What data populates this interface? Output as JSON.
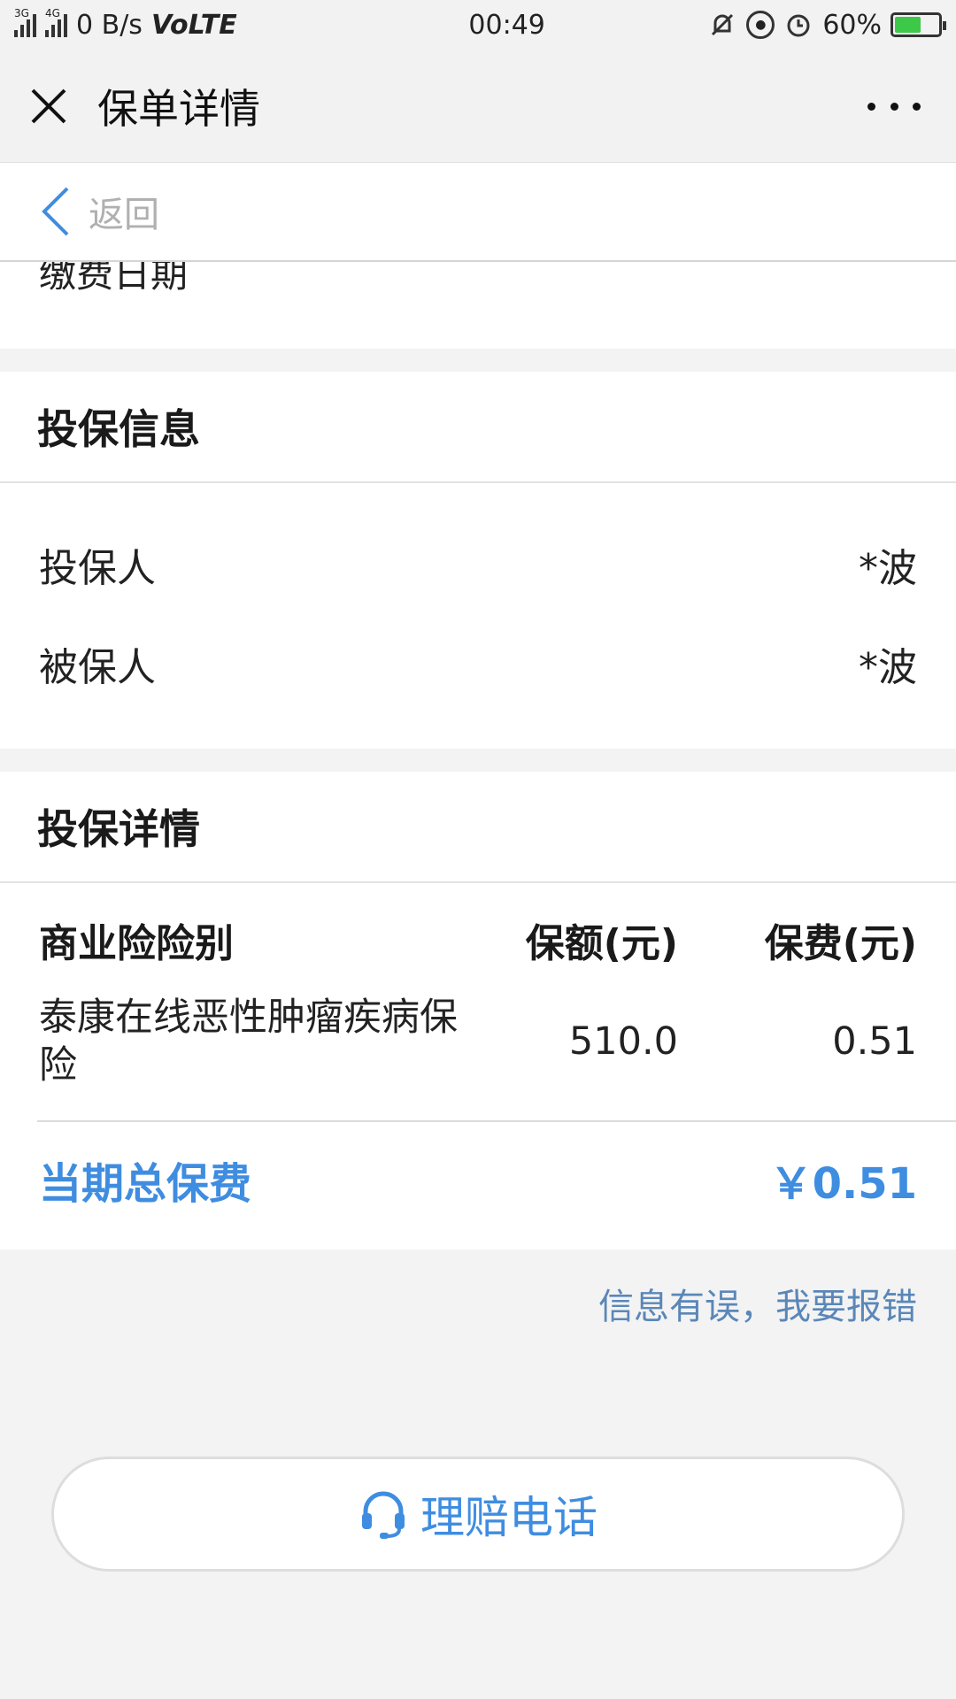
{
  "status_bar": {
    "net_3g": "3G",
    "net_4g": "4G",
    "speed": "0 B/s",
    "volte": "VoLTE",
    "time": "00:49",
    "battery": "60%"
  },
  "header": {
    "title": "保单详情"
  },
  "nav": {
    "back_label": "返回"
  },
  "payment": {
    "date_label": "缴费日期"
  },
  "insured_info": {
    "title": "投保信息",
    "rows": [
      {
        "label": "投保人",
        "value": "*波"
      },
      {
        "label": "被保人",
        "value": "*波"
      }
    ]
  },
  "details": {
    "title": "投保详情",
    "columns": [
      "商业险险别",
      "保额(元)",
      "保费(元)"
    ],
    "rows": [
      {
        "name": "泰康在线恶性肿瘤疾病保险",
        "amount": "510.0",
        "premium": "0.51"
      }
    ],
    "total_label": "当期总保费",
    "total_value": "￥0.51"
  },
  "report_link": "信息有误，我要报错",
  "claim_button": {
    "label": "理赔电话"
  },
  "colors": {
    "accent": "#3f8de0",
    "link": "#5a87b8",
    "battery": "#3ec84a"
  }
}
